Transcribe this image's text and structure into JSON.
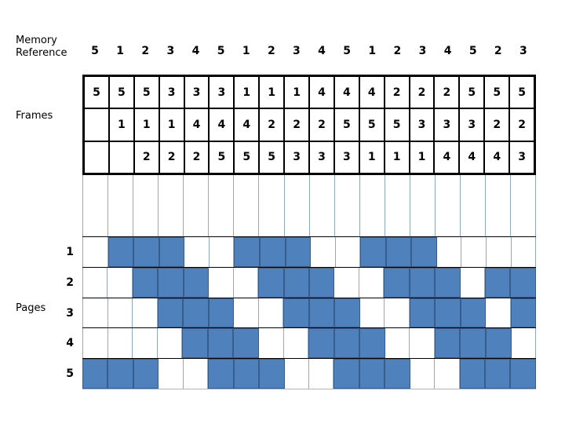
{
  "labels": {
    "memory_reference": "Memory\nReference",
    "frames": "Frames",
    "pages": "Pages"
  },
  "memory_reference": {
    "sequence": [
      "5",
      "1",
      "2",
      "3",
      "4",
      "5",
      "1",
      "2",
      "3",
      "4",
      "5",
      "1",
      "2",
      "3",
      "4",
      "5",
      "2",
      "3"
    ]
  },
  "frames": {
    "rows": [
      [
        "5",
        "5",
        "5",
        "3",
        "3",
        "3",
        "1",
        "1",
        "1",
        "4",
        "4",
        "4",
        "2",
        "2",
        "2",
        "5",
        "5",
        "5"
      ],
      [
        "",
        "1",
        "1",
        "1",
        "4",
        "4",
        "4",
        "2",
        "2",
        "2",
        "5",
        "5",
        "5",
        "3",
        "3",
        "3",
        "2",
        "2"
      ],
      [
        "",
        "",
        "2",
        "2",
        "2",
        "5",
        "5",
        "5",
        "3",
        "3",
        "3",
        "1",
        "1",
        "1",
        "4",
        "4",
        "4",
        "3"
      ]
    ]
  },
  "pages": {
    "row_labels": [
      "1",
      "2",
      "3",
      "4",
      "5"
    ],
    "column_count": 18,
    "occupancy": [
      [
        0,
        1,
        1,
        1,
        0,
        0,
        1,
        1,
        1,
        0,
        0,
        1,
        1,
        1,
        0,
        0,
        0,
        0
      ],
      [
        0,
        0,
        1,
        1,
        1,
        0,
        0,
        1,
        1,
        1,
        0,
        0,
        1,
        1,
        1,
        0,
        1,
        1
      ],
      [
        0,
        0,
        0,
        1,
        1,
        1,
        0,
        0,
        1,
        1,
        1,
        0,
        0,
        1,
        1,
        1,
        0,
        1
      ],
      [
        0,
        0,
        0,
        0,
        1,
        1,
        1,
        0,
        0,
        1,
        1,
        1,
        0,
        0,
        1,
        1,
        1,
        0
      ],
      [
        1,
        1,
        1,
        0,
        0,
        1,
        1,
        1,
        0,
        0,
        1,
        1,
        1,
        0,
        0,
        1,
        1,
        1
      ]
    ]
  },
  "colors": {
    "fill": "#4F81BD",
    "fill_border": "#385D8A",
    "grid_line": "#8fa9c4",
    "table_border": "#000000",
    "text": "#000000",
    "background": "#ffffff"
  }
}
